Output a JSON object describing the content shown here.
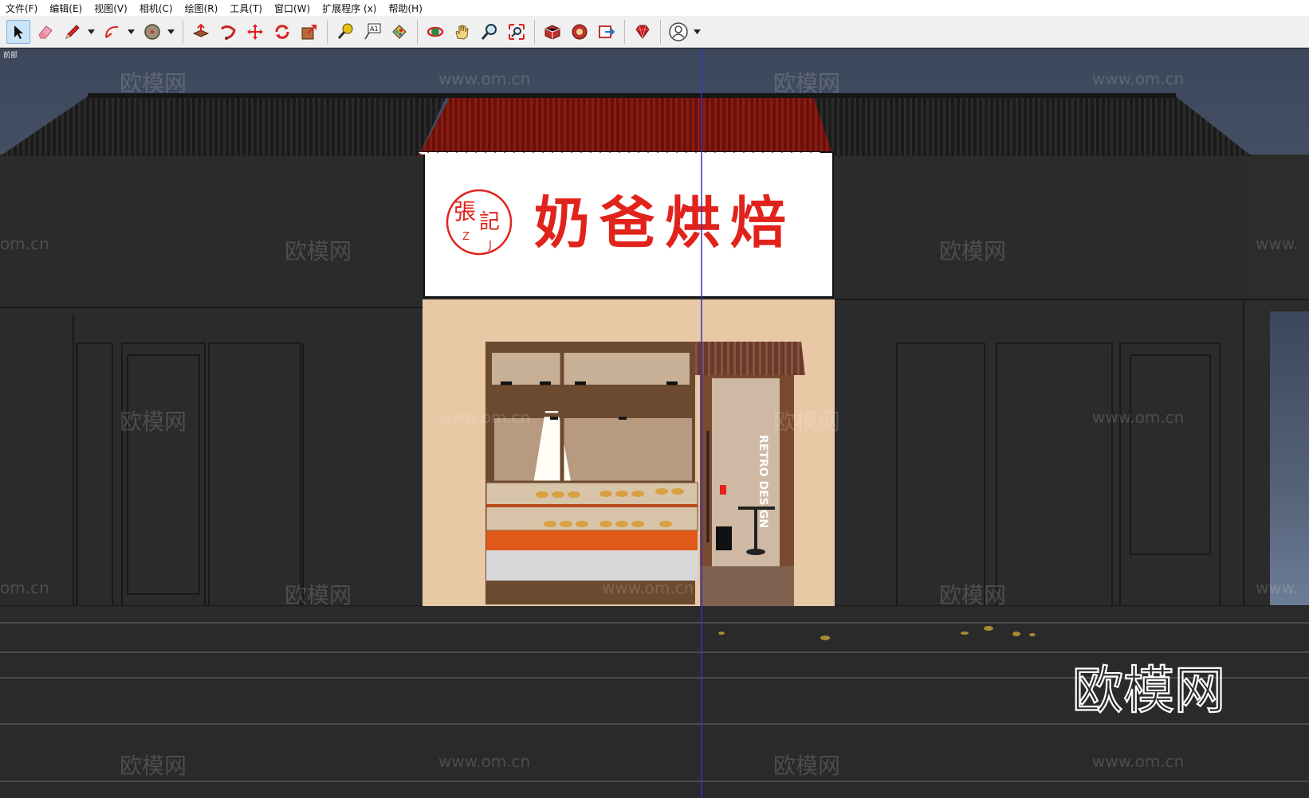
{
  "menu": {
    "items": [
      {
        "label": "文件(F)",
        "name": "menu-file"
      },
      {
        "label": "编辑(E)",
        "name": "menu-edit"
      },
      {
        "label": "视图(V)",
        "name": "menu-view"
      },
      {
        "label": "相机(C)",
        "name": "menu-camera"
      },
      {
        "label": "绘图(R)",
        "name": "menu-draw"
      },
      {
        "label": "工具(T)",
        "name": "menu-tools"
      },
      {
        "label": "窗口(W)",
        "name": "menu-window"
      },
      {
        "label": "扩展程序 (x)",
        "name": "menu-extensions"
      },
      {
        "label": "帮助(H)",
        "name": "menu-help"
      }
    ]
  },
  "toolbar": {
    "tools": [
      "select-tool-icon",
      "eraser-tool-icon",
      "pencil-tool-icon",
      "arc-tool-icon",
      "circle-tool-icon",
      "pushpull-tool-icon",
      "followme-tool-icon",
      "move-tool-icon",
      "rotate-tool-icon",
      "scale-tool-icon",
      "tape-measure-icon",
      "text-tool-icon",
      "paint-bucket-icon",
      "orbit-tool-icon",
      "pan-tool-icon",
      "zoom-tool-icon",
      "zoom-extents-icon",
      "3d-warehouse-icon",
      "extension-warehouse-icon",
      "send-to-layout-icon",
      "ruby-console-icon",
      "account-icon"
    ],
    "text_tool_label": "A1"
  },
  "viewport": {
    "scene_label": "前部",
    "colors": {
      "sky": "#3f4a5e",
      "wall": "#2b2b2b",
      "roof": "#1c1c1c",
      "red_roof": "#7a1410",
      "axis": "#3434c8",
      "interior": "#e9c8a6"
    }
  },
  "shop": {
    "seal_top": "張",
    "seal_right": "記",
    "seal_left_letter": "Z",
    "seal_right_letter": "J",
    "sign_text": "奶爸烘焙",
    "door_text": "RETRO DESIGN",
    "sign_color": "#e0231b"
  },
  "watermarks": {
    "brand": "欧模网",
    "site": "www.om.cn",
    "partial_site": "om.cn",
    "partial_www": "www."
  }
}
